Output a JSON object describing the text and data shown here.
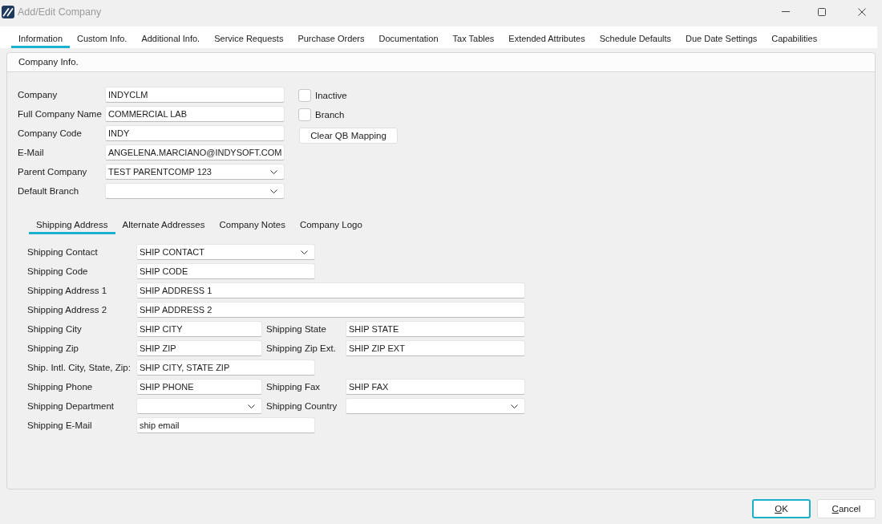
{
  "window": {
    "title": "Add/Edit Company"
  },
  "tabs": [
    {
      "label": "Information",
      "selected": true
    },
    {
      "label": "Custom Info.",
      "selected": false
    },
    {
      "label": "Additional Info.",
      "selected": false
    },
    {
      "label": "Service Requests",
      "selected": false
    },
    {
      "label": "Purchase Orders",
      "selected": false
    },
    {
      "label": "Documentation",
      "selected": false
    },
    {
      "label": "Tax Tables",
      "selected": false
    },
    {
      "label": "Extended Attributes",
      "selected": false
    },
    {
      "label": "Schedule Defaults",
      "selected": false
    },
    {
      "label": "Due Date Settings",
      "selected": false
    },
    {
      "label": "Capabilities",
      "selected": false
    }
  ],
  "company_info": {
    "title": "Company Info.",
    "fields": [
      {
        "label": "Company",
        "kind": "text",
        "value": "INDYCLM"
      },
      {
        "label": "Full Company Name",
        "kind": "text",
        "value": "COMMERCIAL LAB"
      },
      {
        "label": "Company Code",
        "kind": "text",
        "value": "INDY"
      },
      {
        "label": "E-Mail",
        "kind": "text",
        "value": "ANGELENA.MARCIANO@INDYSOFT.COM"
      },
      {
        "label": "Parent Company",
        "kind": "dropdown",
        "value": "TEST PARENTCOMP 123"
      },
      {
        "label": "Default Branch",
        "kind": "dropdown"
      }
    ],
    "checkboxes": [
      {
        "label": "Inactive",
        "checked": false
      },
      {
        "label": "Branch",
        "checked": false
      }
    ],
    "clear_qb_button": {
      "label": "Clear QB Mapping"
    }
  },
  "address_tabs": [
    {
      "label": "Shipping Address",
      "selected": true
    },
    {
      "label": "Alternate Addresses",
      "selected": false
    },
    {
      "label": "Company Notes",
      "selected": false
    },
    {
      "label": "Company Logo",
      "selected": false
    }
  ],
  "shipping_rows": [
    {
      "fields": [
        {
          "label": "Shipping Contact",
          "kind": "dropdown",
          "value": "SHIP CONTACT"
        }
      ]
    },
    {
      "fields": [
        {
          "label": "Shipping Code",
          "kind": "text",
          "value": "SHIP CODE"
        }
      ]
    },
    {
      "fields": [
        {
          "label": "Shipping Address 1",
          "kind": "text",
          "value": "SHIP ADDRESS 1"
        }
      ]
    },
    {
      "fields": [
        {
          "label": "Shipping Address 2",
          "kind": "text",
          "value": "SHIP ADDRESS 2"
        }
      ]
    },
    {
      "fields": [
        {
          "label": "Shipping City",
          "kind": "text",
          "value": "SHIP CITY"
        },
        {
          "label": "Shipping State",
          "kind": "text",
          "value": "SHIP STATE"
        }
      ]
    },
    {
      "fields": [
        {
          "label": "Shipping Zip",
          "kind": "text",
          "value": "SHIP ZIP"
        },
        {
          "label": "Shipping Zip Ext.",
          "kind": "text",
          "value": "SHIP ZIP EXT"
        }
      ]
    },
    {
      "fields": [
        {
          "label": "Ship. Intl. City, State, Zip:",
          "kind": "text",
          "value": "SHIP CITY, STATE ZIP"
        }
      ]
    },
    {
      "fields": [
        {
          "label": "Shipping Phone",
          "kind": "text",
          "value": "SHIP PHONE"
        },
        {
          "label": "Shipping Fax",
          "kind": "text",
          "value": "SHIP FAX"
        }
      ]
    },
    {
      "fields": [
        {
          "label": "Shipping Department",
          "kind": "dropdown"
        },
        {
          "label": "Shipping Country",
          "kind": "dropdown"
        }
      ]
    },
    {
      "fields": [
        {
          "label": "Shipping E-Mail",
          "kind": "text",
          "value": "ship email"
        }
      ]
    }
  ],
  "buttons": [
    {
      "label": "OK",
      "default": true
    },
    {
      "label": "Cancel",
      "default": false
    }
  ]
}
